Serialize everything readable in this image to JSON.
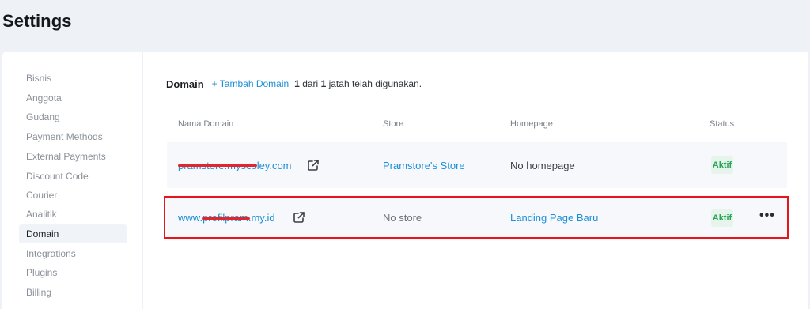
{
  "page": {
    "title": "Settings"
  },
  "sidebar": {
    "items": [
      {
        "label": "Bisnis"
      },
      {
        "label": "Anggota"
      },
      {
        "label": "Gudang"
      },
      {
        "label": "Payment Methods"
      },
      {
        "label": "External Payments"
      },
      {
        "label": "Discount Code"
      },
      {
        "label": "Courier"
      },
      {
        "label": "Analitik"
      },
      {
        "label": "Domain",
        "active": true
      },
      {
        "label": "Integrations"
      },
      {
        "label": "Plugins"
      },
      {
        "label": "Billing"
      }
    ]
  },
  "domain_section": {
    "title": "Domain",
    "add_label": "+ Tambah Domain",
    "usage_used": "1",
    "usage_mid": "dari",
    "usage_total": "1",
    "usage_tail": "jatah telah digunakan."
  },
  "table": {
    "columns": [
      "Nama Domain",
      "Store",
      "Homepage",
      "Status"
    ],
    "rows": [
      {
        "domain_prefix": "pramstore.mysesley",
        "domain_suffix": ".com",
        "store": "Pramstore's Store",
        "homepage": "No homepage",
        "status": "Aktif"
      },
      {
        "domain_prefix": "www.",
        "domain_mid": "profilpram",
        "domain_suffix": ".my.id",
        "store": "No store",
        "homepage": "Landing Page Baru",
        "status": "Aktif"
      }
    ]
  },
  "colors": {
    "link": "#1d8fd6",
    "active_badge_bg": "#e6f4ec",
    "active_badge_text": "#27a55a",
    "highlight_border": "#e8141c",
    "redaction": "#e3262b"
  },
  "icons": {
    "external_link": "external-link-icon",
    "more": "more-horizontal-icon"
  },
  "glyphs": {
    "more": "•••"
  }
}
